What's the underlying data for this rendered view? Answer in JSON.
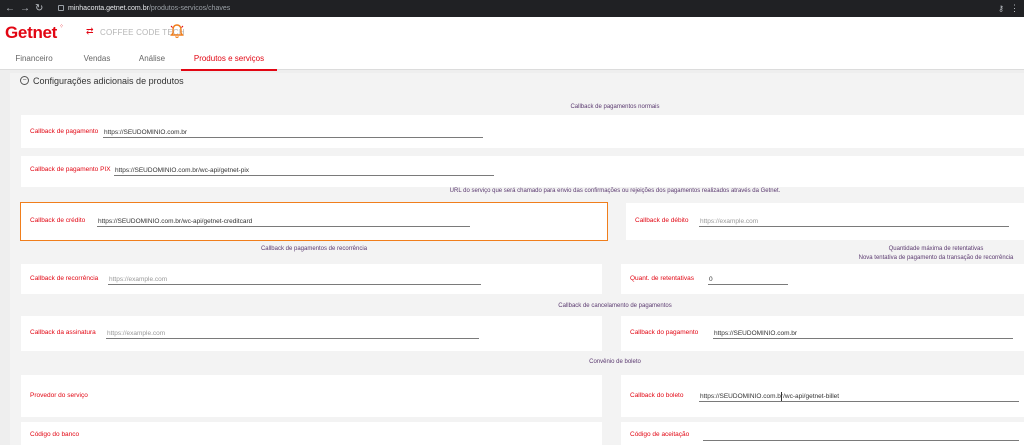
{
  "browser": {
    "url_host": "minhaconta.getnet.com.br",
    "url_path": "/produtos-servicos/chaves"
  },
  "header": {
    "logo": "Getnet",
    "merchant_name": "COFFEE CODE TECH"
  },
  "tabs": [
    {
      "label": "Financeiro"
    },
    {
      "label": "Vendas"
    },
    {
      "label": "Análise"
    },
    {
      "label": "Produtos e serviços",
      "active": true
    }
  ],
  "section": {
    "title": "Configurações adicionais de produtos"
  },
  "subtitles": {
    "normal": "Callback de pagamentos normais",
    "url_info": "URL do serviço que será chamado para envio das confirmações ou rejeições dos pagamentos realizados através da Getnet.",
    "recurrence": "Callback de pagamentos de recorrência",
    "max_retries": "Quantidade máxima de retentativas",
    "new_attempt": "Nova tentativa de pagamento da transação de recorrência",
    "cancel": "Callback de cancelamento de pagamentos",
    "boleto": "Convênio de boleto"
  },
  "fields": {
    "payment": {
      "label": "Callback de pagamento",
      "value": "https://SEUDOMINIO.com.br",
      "placeholder": ""
    },
    "pix": {
      "label": "Callback de pagamento PIX",
      "value": "https://SEUDOMINIO.com.br/wc-api/getnet-pix",
      "placeholder": ""
    },
    "credit": {
      "label": "Callback de crédito",
      "value": "https://SEUDOMINIO.com.br/wc-api/getnet-creditcard",
      "placeholder": ""
    },
    "debit": {
      "label": "Callback de débito",
      "value": "",
      "placeholder": "https://example.com"
    },
    "recurrence": {
      "label": "Callback de recorrência",
      "value": "",
      "placeholder": "https://example.com"
    },
    "retries": {
      "label": "Quant. de retentativas",
      "value": "0",
      "placeholder": ""
    },
    "subscription": {
      "label": "Callback da assinatura",
      "value": "",
      "placeholder": "https://example.com"
    },
    "cancel_payment": {
      "label": "Callback do pagamento",
      "value": "https://SEUDOMINIO.com.br",
      "placeholder": ""
    },
    "provider": {
      "label": "Provedor do serviço"
    },
    "boleto": {
      "label": "Callback do boleto",
      "value": "https://SEUDOMINIO.com.br/wc-api/getnet-billet",
      "placeholder": ""
    },
    "bank_code": {
      "label": "Código do banco"
    },
    "acceptance_code": {
      "label": "Código de aceitação",
      "value": "",
      "placeholder": ""
    }
  },
  "colors": {
    "brand": "#e20613",
    "highlight": "#f07e1c",
    "subtitle": "#5b3a70"
  }
}
